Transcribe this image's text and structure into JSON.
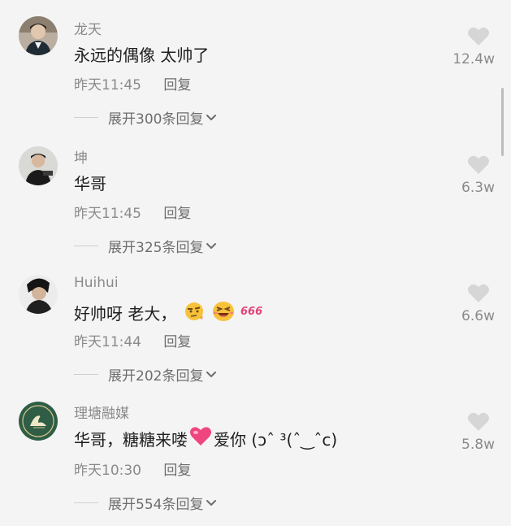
{
  "comments": [
    {
      "username": "龙天",
      "text": "永远的偶像 太帅了",
      "time": "昨天11:45",
      "reply_label": "回复",
      "expand_label": "展开300条回复",
      "likes": "12.4w",
      "avatar": "portrait-avatar"
    },
    {
      "username": "坤",
      "text": "华哥",
      "time": "昨天11:45",
      "reply_label": "回复",
      "expand_label": "展开325条回复",
      "likes": "6.3w",
      "avatar": "portrait-avatar"
    },
    {
      "username": "Huihui",
      "text": "好帅呀 老大，",
      "emojis": [
        "thinking-emoji",
        "grinning-emoji",
        "666-emoji"
      ],
      "time": "昨天11:44",
      "reply_label": "回复",
      "expand_label": "展开202条回复",
      "likes": "6.6w",
      "avatar": "portrait-avatar"
    },
    {
      "username": "理塘融媒",
      "text_before": "华哥，糖糖来喽",
      "text_after": "爱你 (ↄˆ ³(ˆ‿ˆc)",
      "emojis": [
        "heart-emoji"
      ],
      "time": "昨天10:30",
      "reply_label": "回复",
      "expand_label": "展开554条回复",
      "likes": "5.8w",
      "avatar": "logo-avatar"
    }
  ],
  "icons": {
    "like": "heart-icon",
    "expand": "chevron-down-icon"
  },
  "colors": {
    "background": "#f4f4f4",
    "muted_text": "#8a8a8a",
    "heart_gray": "#d6d6d6",
    "logo_green": "#2f5d46"
  }
}
